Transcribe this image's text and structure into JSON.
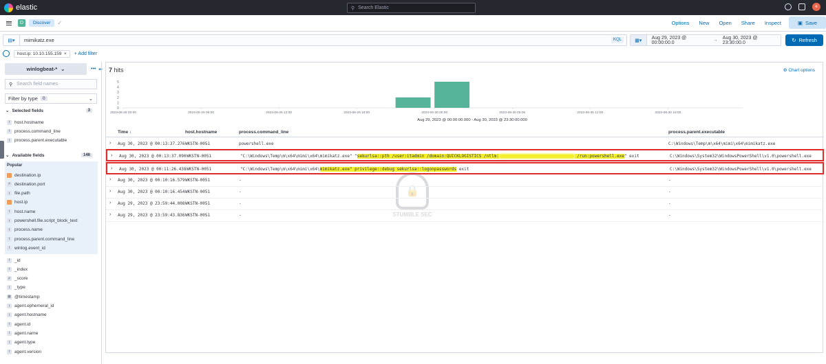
{
  "app": {
    "brand": "elastic",
    "search_placeholder": "Search Elastic",
    "avatar": "e"
  },
  "nav": {
    "space_badge": "D",
    "app_chip": "Discover",
    "links": [
      "Options",
      "New",
      "Open",
      "Share",
      "Inspect"
    ],
    "save_label": "Save"
  },
  "query": {
    "value": "mimikatz.exe",
    "language": "KQL"
  },
  "time": {
    "from": "Aug 29, 2023 @ 00:00:00.0",
    "to": "Aug 30, 2023 @ 23:30:00.0",
    "refresh_label": "Refresh"
  },
  "filters": {
    "pill": "host.ip: 10.10.155.159",
    "add_label": "+ Add filter"
  },
  "sidebar": {
    "index_pattern": "winlogbeat-*",
    "search_placeholder": "Search field names",
    "filter_type_label": "Filter by type",
    "filter_type_count": "0",
    "selected_label": "Selected fields",
    "selected_count": "3",
    "selected_fields": [
      {
        "type": "t",
        "name": "host.hostname"
      },
      {
        "type": "t",
        "name": "process.command_line"
      },
      {
        "type": "t",
        "name": "process.parent.executable"
      }
    ],
    "available_label": "Available fields",
    "available_count": "146",
    "popular_label": "Popular",
    "popular_fields": [
      {
        "type": "geo",
        "name": "destination.ip"
      },
      {
        "type": "#",
        "name": "destination.port"
      },
      {
        "type": "t",
        "name": "file.path"
      },
      {
        "type": "geo",
        "name": "host.ip"
      },
      {
        "type": "t",
        "name": "host.name"
      },
      {
        "type": "t",
        "name": "powershell.file.script_block_text"
      },
      {
        "type": "t",
        "name": "process.name"
      },
      {
        "type": "t",
        "name": "process.parent.command_line"
      },
      {
        "type": "t",
        "name": "winlog.event_id"
      }
    ],
    "other_fields": [
      {
        "type": "t",
        "name": "_id"
      },
      {
        "type": "t",
        "name": "_index"
      },
      {
        "type": "#",
        "name": "_score"
      },
      {
        "type": "t",
        "name": "_type"
      },
      {
        "type": "cal",
        "name": "@timestamp"
      },
      {
        "type": "t",
        "name": "agent.ephemeral_id"
      },
      {
        "type": "t",
        "name": "agent.hostname"
      },
      {
        "type": "t",
        "name": "agent.id"
      },
      {
        "type": "t",
        "name": "agent.name"
      },
      {
        "type": "t",
        "name": "agent.type"
      },
      {
        "type": "t",
        "name": "agent.version"
      }
    ]
  },
  "results": {
    "hits_count": "7",
    "hits_label": "hits",
    "chart_options": "Chart options"
  },
  "chart_data": {
    "type": "bar",
    "y_ticks": [
      "5",
      "4",
      "3",
      "2",
      "1",
      "0"
    ],
    "ylim": [
      0,
      5
    ],
    "x_ticks": [
      "2023-08-29 00:00",
      "2023-08-29 06:00",
      "2023-08-29 12:00",
      "2023-08-29 18:00",
      "2023-08-30 00:00",
      "2023-08-30 06:00",
      "2023-08-30 12:00",
      "2023-08-30 18:00"
    ],
    "bars": [
      {
        "x": "2023-08-29 21:00",
        "value": 2
      },
      {
        "x": "2023-08-30 00:00",
        "value": 5
      }
    ],
    "xlabel": "Aug 29, 2023 @ 00:00:00.000 - Aug 30, 2023 @ 23:30:00.000",
    "color": "#54b399"
  },
  "table": {
    "columns": [
      "Time",
      "host.hostname",
      "process.command_line",
      "process.parent.executable"
    ],
    "rows": [
      {
        "time": "Aug 30, 2023 @ 00:13:37.276",
        "host": "WKSTN-0051",
        "cmd_plain": "powershell.exe",
        "parent": "C:\\Windows\\Temp\\m\\x64\\mimi\\x64\\mimikatz.exe"
      },
      {
        "time": "Aug 30, 2023 @ 00:13:37.090",
        "host": "WKSTN-0051",
        "cmd_pre": "\"C:\\Windows\\Temp\\m\\x64\\mimi\\x64\\mimikatz.exe\" \"",
        "cmd_hl1": "sekurlsa::pth /user:itadmin /domain:QUICKLOGISTICS /ntlm:",
        "cmd_hl2": " /run:powershell.exe",
        "cmd_post": "\" exit",
        "parent": "C:\\Windows\\System32\\WindowsPowerShell\\v1.0\\powershell.exe"
      },
      {
        "time": "Aug 30, 2023 @ 00:11:26.438",
        "host": "WKSTN-0051",
        "cmd_pre": "\"C:\\Windows\\Temp\\m\\x64\\mimi\\x64\\",
        "cmd_hl1": "mimikatz.exe\" privilege::debug sekurlsa::logonpasswords",
        "cmd_post": " exit",
        "parent": "C:\\Windows\\System32\\WindowsPowerShell\\v1.0\\powershell.exe"
      },
      {
        "time": "Aug 30, 2023 @ 00:10:16.579",
        "host": "WKSTN-0051",
        "cmd_plain": "-",
        "parent": "-"
      },
      {
        "time": "Aug 30, 2023 @ 00:10:16.454",
        "host": "WKSTN-0051",
        "cmd_plain": "-",
        "parent": "-"
      },
      {
        "time": "Aug 29, 2023 @ 23:59:44.008",
        "host": "WKSTN-0051",
        "cmd_plain": "-",
        "parent": "-"
      },
      {
        "time": "Aug 29, 2023 @ 23:59:43.836",
        "host": "WKSTN-0051",
        "cmd_plain": "-",
        "parent": "-"
      }
    ]
  },
  "watermark": "STUMBLE SEC"
}
